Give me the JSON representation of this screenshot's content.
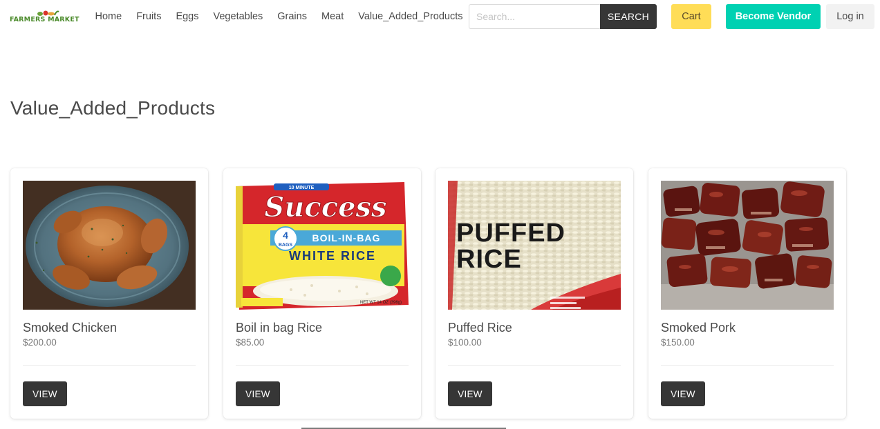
{
  "brand": {
    "logo_text": "FARMERS MARKET"
  },
  "nav": {
    "links": [
      "Home",
      "Fruits",
      "Eggs",
      "Vegetables",
      "Grains",
      "Meat",
      "Value_Added_Products"
    ]
  },
  "search": {
    "placeholder": "Search...",
    "button_label": "SEARCH"
  },
  "actions": {
    "cart_label": "Cart",
    "vendor_label": "Become Vendor",
    "login_label": "Log in"
  },
  "colors": {
    "cart": "#ffdd57",
    "vendor": "#00d1b2",
    "dark_button": "#363636"
  },
  "page": {
    "title": "Value_Added_Products"
  },
  "products": [
    {
      "name": "Smoked Chicken",
      "price": "$200.00",
      "image_icon": "smoked-chicken-photo",
      "view_label": "VIEW"
    },
    {
      "name": "Boil in bag Rice",
      "price": "$85.00",
      "image_icon": "rice-box-photo",
      "view_label": "VIEW",
      "image_text": {
        "brand": "Success",
        "top": "10 MINUTE",
        "count": "4",
        "count_label": "BAGS",
        "band": "BOIL-IN-BAG",
        "type": "WHITE RICE",
        "net": "NET WT 14 OZ (396g)"
      }
    },
    {
      "name": "Puffed Rice",
      "price": "$100.00",
      "image_icon": "puffed-rice-bag-photo",
      "view_label": "VIEW",
      "image_text": {
        "line1": "PUFFED",
        "line2": "RICE"
      }
    },
    {
      "name": "Smoked Pork",
      "price": "$150.00",
      "image_icon": "smoked-pork-photo",
      "view_label": "VIEW"
    }
  ]
}
